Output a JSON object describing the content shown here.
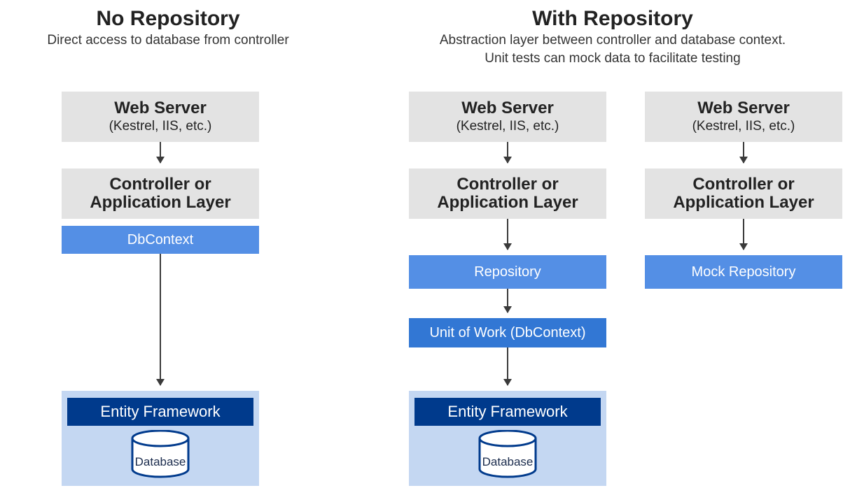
{
  "left": {
    "title": "No Repository",
    "subtitle": "Direct access to database from controller",
    "webserver_title": "Web Server",
    "webserver_sub": "(Kestrel, IIS, etc.)",
    "controller_line1": "Controller or",
    "controller_line2": "Application Layer",
    "dbcontext": "DbContext",
    "ef": "Entity Framework",
    "database": "Database"
  },
  "right": {
    "title": "With Repository",
    "subtitle1": "Abstraction layer between controller and database context.",
    "subtitle2": "Unit tests can mock data to facilitate testing",
    "colA": {
      "webserver_title": "Web Server",
      "webserver_sub": "(Kestrel, IIS, etc.)",
      "controller_line1": "Controller or",
      "controller_line2": "Application Layer",
      "repository": "Repository",
      "uow": "Unit of Work (DbContext)",
      "ef": "Entity Framework",
      "database": "Database"
    },
    "colB": {
      "webserver_title": "Web Server",
      "webserver_sub": "(Kestrel, IIS, etc.)",
      "controller_line1": "Controller or",
      "controller_line2": "Application Layer",
      "mock_repo": "Mock Repository"
    }
  }
}
